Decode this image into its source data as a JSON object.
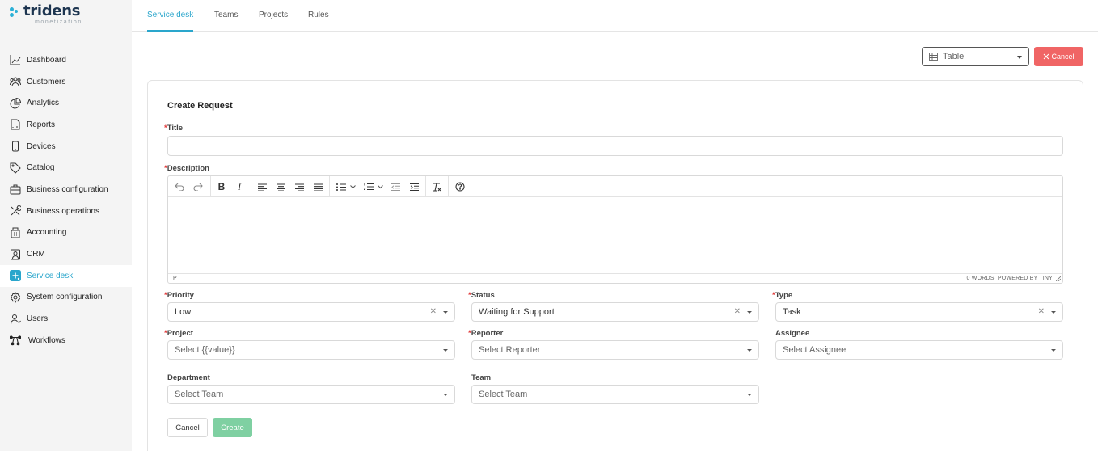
{
  "brand": {
    "name": "tridens",
    "tagline": "monetization",
    "color": "#2bb0d6"
  },
  "sidebar": {
    "items": [
      {
        "label": "Dashboard",
        "icon": "dashboard-chart-icon"
      },
      {
        "label": "Customers",
        "icon": "users-group-icon"
      },
      {
        "label": "Analytics",
        "icon": "pie-chart-icon"
      },
      {
        "label": "Reports",
        "icon": "report-document-icon"
      },
      {
        "label": "Devices",
        "icon": "mobile-device-icon"
      },
      {
        "label": "Catalog",
        "icon": "tag-icon"
      },
      {
        "label": "Business configuration",
        "icon": "briefcase-icon"
      },
      {
        "label": "Business operations",
        "icon": "tools-icon"
      },
      {
        "label": "Accounting",
        "icon": "accounting-building-icon"
      },
      {
        "label": "CRM",
        "icon": "contact-card-icon"
      },
      {
        "label": "Service desk",
        "icon": "service-desk-icon",
        "active": true
      },
      {
        "label": "System configuration",
        "icon": "gear-icon"
      },
      {
        "label": "Users",
        "icon": "user-icon"
      },
      {
        "label": "Workflows",
        "icon": "workflow-icon"
      }
    ]
  },
  "tabs": [
    {
      "label": "Service desk",
      "active": true
    },
    {
      "label": "Teams"
    },
    {
      "label": "Projects"
    },
    {
      "label": "Rules"
    }
  ],
  "toolbar": {
    "view_label": "Table",
    "cancel_label": "Cancel",
    "cancel_color": "#f06565"
  },
  "form": {
    "title": "Create Request",
    "fields": {
      "title": {
        "label": "Title",
        "required": true,
        "value": ""
      },
      "description": {
        "label": "Description",
        "required": true
      },
      "priority": {
        "label": "Priority",
        "value": "Low"
      },
      "status": {
        "label": "Status",
        "value": "Waiting for Support"
      },
      "type": {
        "label": "Type",
        "value": "Task"
      },
      "project": {
        "label": "Project",
        "placeholder": "Select {{value}}"
      },
      "reporter": {
        "label": "Reporter",
        "placeholder": "Select Reporter"
      },
      "assignee": {
        "label": "Assignee",
        "placeholder": "Select Assignee"
      },
      "department": {
        "label": "Department",
        "placeholder": "Select Team"
      },
      "team": {
        "label": "Team",
        "placeholder": "Select Team"
      }
    },
    "editor": {
      "status_path": "P",
      "word_count": "0 WORDS",
      "powered_by": "POWERED BY TINY"
    },
    "cancel_label": "Cancel",
    "create_label": "Create",
    "create_color": "#7fd0a2"
  },
  "accent_color": "#2aa6cc"
}
